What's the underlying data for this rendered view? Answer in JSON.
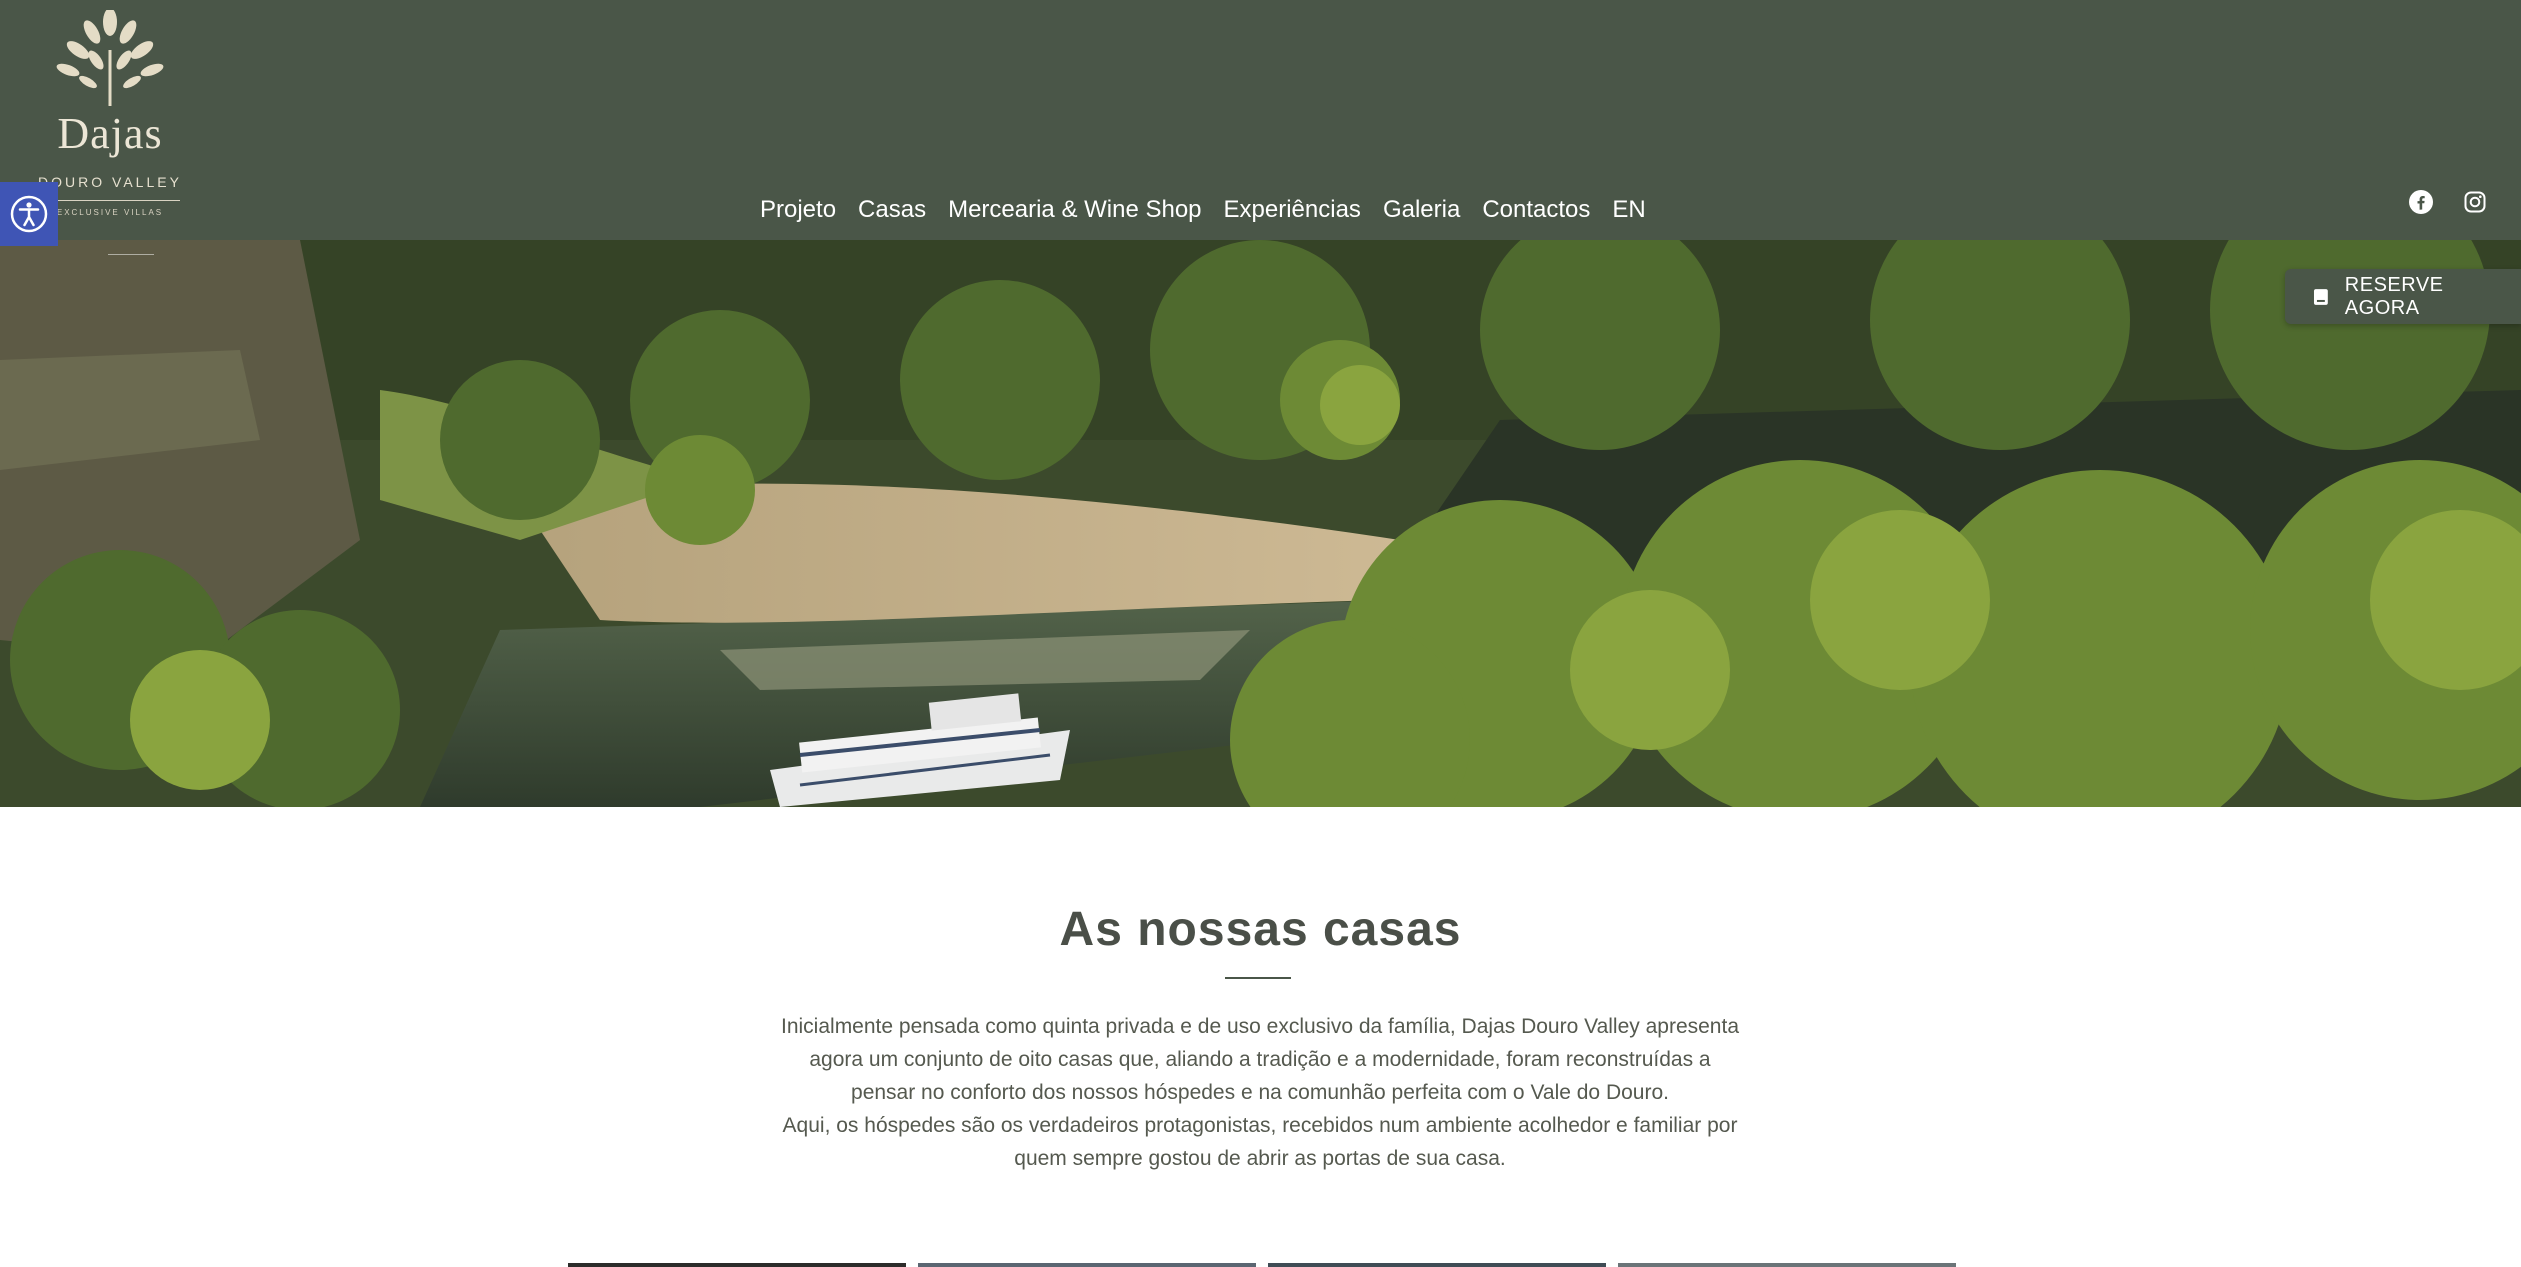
{
  "header": {
    "logo": {
      "brand": "Dajas",
      "subtitle": "DOURO VALLEY",
      "tagline": "EXCLUSIVE  VILLAS"
    },
    "nav": [
      {
        "label": "Projeto"
      },
      {
        "label": "Casas"
      },
      {
        "label": "Mercearia & Wine Shop"
      },
      {
        "label": "Experiências"
      },
      {
        "label": "Galeria"
      },
      {
        "label": "Contactos"
      },
      {
        "label": "EN"
      }
    ],
    "social": [
      {
        "icon": "facebook-icon"
      },
      {
        "icon": "instagram-icon"
      }
    ]
  },
  "accessibility": {
    "icon": "accessibility-icon"
  },
  "reserve": {
    "label": "RESERVE AGORA",
    "icon": "book-icon"
  },
  "section": {
    "title": "As nossas casas",
    "paragraphs": [
      "Inicialmente pensada como quinta privada e de uso exclusivo da família, Dajas Douro Valley apresenta agora um conjunto de oito casas que, aliando a tradição e a modernidade, foram reconstruídas a pensar no conforto dos nossos hóspedes e na comunhão perfeita com o Vale do Douro.",
      "Aqui, os hóspedes são os verdadeiros protagonistas, recebidos num ambiente acolhedor e familiar por quem sempre gostou de abrir as portas de sua casa."
    ]
  },
  "colors": {
    "header_bg": "#4a5648",
    "accent": "#3f55b5",
    "text": "#4a4f48"
  }
}
